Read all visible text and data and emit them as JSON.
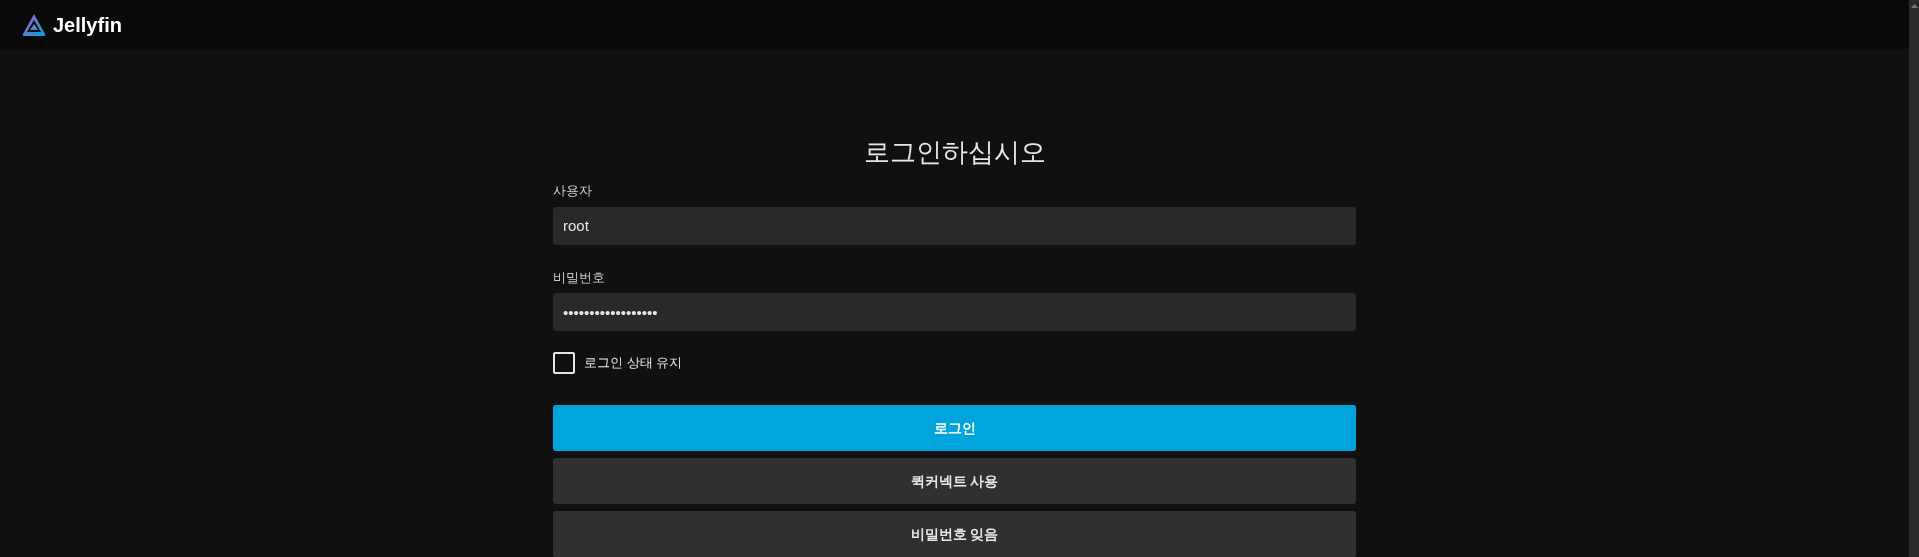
{
  "header": {
    "app_name": "Jellyfin"
  },
  "title": "로그인하십시오",
  "fields": [
    {
      "label": "사용자",
      "value": "root"
    },
    {
      "label": "비밀번호",
      "value": "••••••••••••••••••"
    }
  ],
  "remember": {
    "label": "로그인 상태 유지",
    "checked": false
  },
  "buttons": [
    {
      "label": "로그인",
      "kind": "primary"
    },
    {
      "label": "퀵커넥트 사용",
      "kind": "secondary"
    },
    {
      "label": "비밀번호 잊음",
      "kind": "secondary"
    }
  ]
}
